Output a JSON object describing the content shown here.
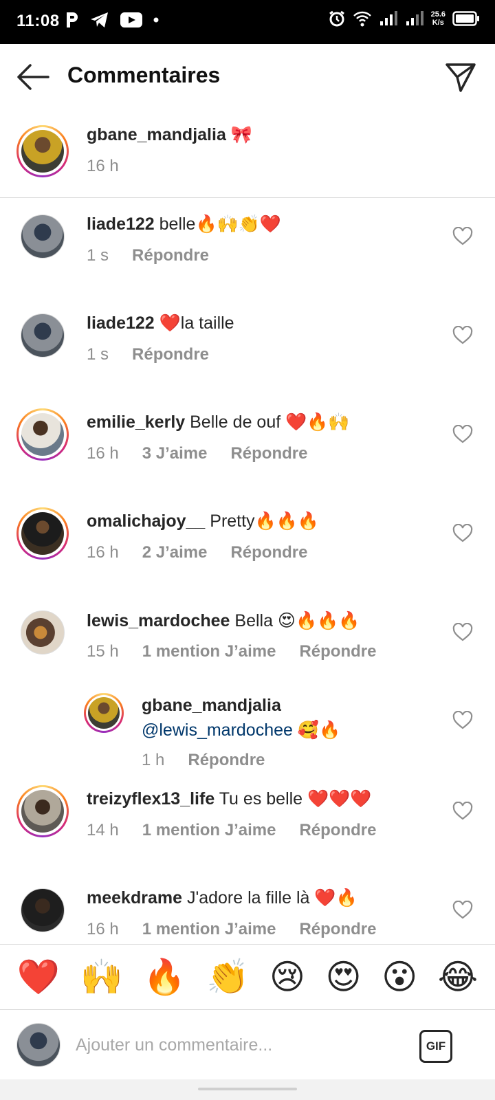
{
  "status_bar": {
    "time": "11:08",
    "speed_value": "25.6",
    "speed_unit": "K/s"
  },
  "header": {
    "title": "Commentaires"
  },
  "caption": {
    "username": "gbane_mandjalia",
    "text": "🎀",
    "time": "16 h"
  },
  "comments": [
    {
      "username": "liade122",
      "text": "belle🔥🙌👏❤️",
      "time": "1 s",
      "likes": "",
      "reply": "Répondre"
    },
    {
      "username": "liade122",
      "text": "❤️la taille",
      "time": "1 s",
      "likes": "",
      "reply": "Répondre"
    },
    {
      "username": "emilie_kerly",
      "text": "Belle de ouf ❤️🔥🙌",
      "time": "16 h",
      "likes": "3 J’aime",
      "reply": "Répondre"
    },
    {
      "username": "omalichajoy__",
      "text": "Pretty🔥🔥🔥",
      "time": "16 h",
      "likes": "2 J’aime",
      "reply": "Répondre"
    },
    {
      "username": "lewis_mardochee",
      "text": "Bella 😍🔥🔥🔥",
      "time": "15 h",
      "likes": "1 mention J’aime",
      "reply": "Répondre"
    },
    {
      "username": "treizyflex13_life",
      "text": "Tu es belle ❤️❤️❤️",
      "time": "14 h",
      "likes": "1 mention J’aime",
      "reply": "Répondre"
    },
    {
      "username": "meekdrame",
      "text": "J'adore la fille là ❤️🔥",
      "time": "16 h",
      "likes": "1 mention J’aime",
      "reply": "Répondre"
    }
  ],
  "reply": {
    "username": "gbane_mandjalia",
    "mention": "@lewis_mardochee",
    "text": "🥰🔥",
    "time": "1 h",
    "reply": "Répondre"
  },
  "emoji_bar": [
    "❤️",
    "🙌",
    "🔥",
    "👏",
    "😢",
    "😍",
    "😮",
    "😂"
  ],
  "composer": {
    "placeholder": "Ajouter un commentaire...",
    "gif_label": "GIF"
  },
  "colors": {
    "ring_gradient": [
      "#feda75",
      "#fa7e1e",
      "#d62976",
      "#962fbf"
    ],
    "mention": "#00376b",
    "meta_gray": "#8e8e8e"
  }
}
